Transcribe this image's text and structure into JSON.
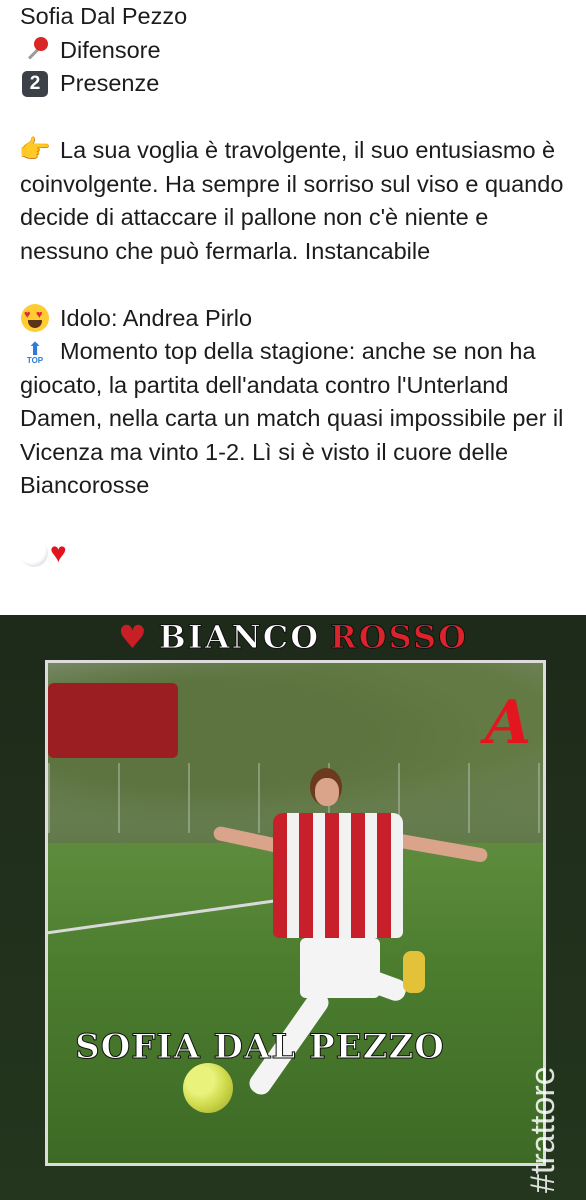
{
  "post": {
    "name": "Sofia Dal Pezzo",
    "role_label": "Difensore",
    "presences_number": "2",
    "presences_label": "Presenze",
    "description": "La sua voglia è travolgente, il suo entusiasmo è coinvolgente. Ha sempre il sorriso sul viso e quando decide di attaccare il pallone non c'è niente e nessuno che può fermarla. Instancabile",
    "idol": "Idolo: Andrea Pirlo",
    "top_moment": "Momento top della stagione: anche se non ha giocato, la partita dell'andata contro l'Unterland Damen, nella carta un match quasi impossibile per il Vicenza ma vinto 1-2. Lì si è visto il cuore delle Biancorosse",
    "top_icon_label": "TOP"
  },
  "image": {
    "brand_part1": "BIANCO",
    "brand_part2": "ROSSO",
    "caption": "SOFIA DAL PEZZO",
    "hashtag": "#trattore",
    "logo_letter": "A"
  },
  "icons": {
    "role": "round-pushpin-icon",
    "presences": "keycap-2-icon",
    "description": "backhand-index-pointing-right-icon",
    "idol": "smiling-face-with-heart-eyes-icon",
    "top": "top-arrow-icon",
    "hearts": [
      "white-heart-icon",
      "red-heart-icon"
    ]
  },
  "colors": {
    "text": "#1c1c1c",
    "accent_red": "#d9242c",
    "top_blue": "#2f7bd5"
  }
}
